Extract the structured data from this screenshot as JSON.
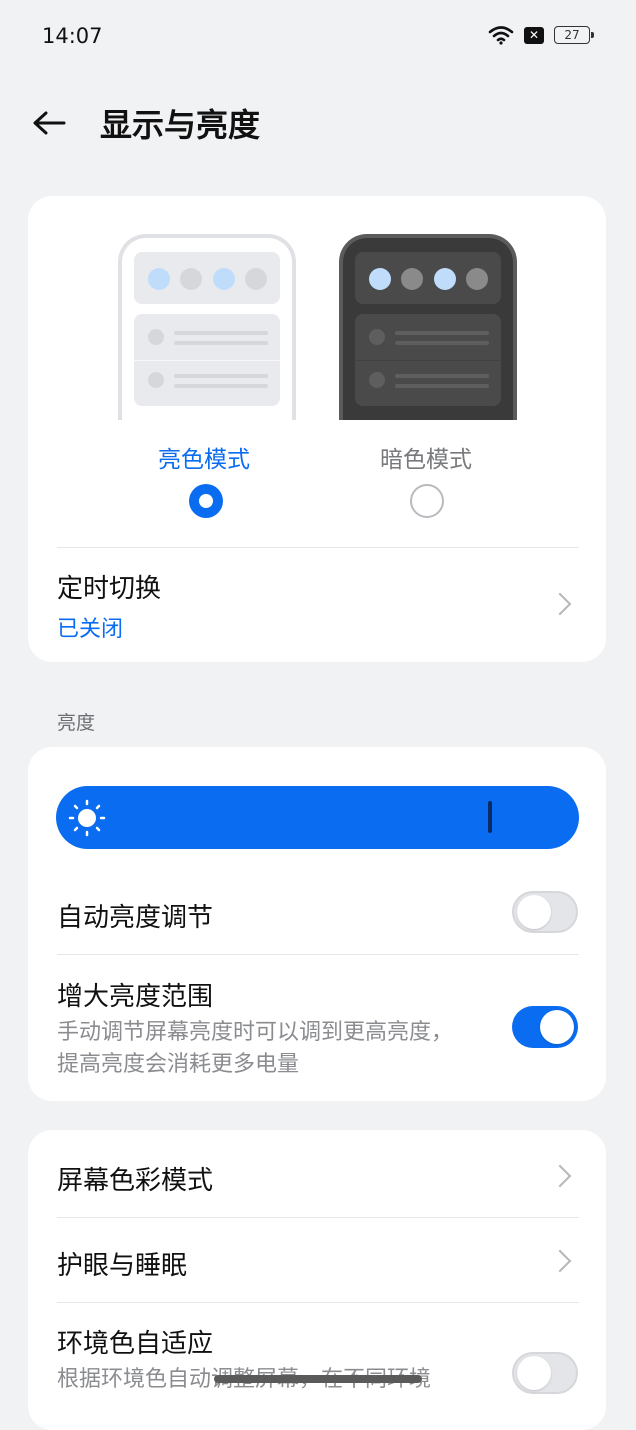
{
  "status": {
    "time": "14:07",
    "battery": "27",
    "wifi_icon": "wifi-icon",
    "sim_icon": "no-sim-icon"
  },
  "header": {
    "title": "显示与亮度",
    "back_icon": "back-arrow-icon"
  },
  "theme": {
    "light_label": "亮色模式",
    "dark_label": "暗色模式",
    "selected": "light",
    "schedule_title": "定时切换",
    "schedule_status": "已关闭"
  },
  "brightness": {
    "section_label": "亮度",
    "level": 0.83,
    "auto_label": "自动亮度调节",
    "auto_on": false,
    "extend_label": "增大亮度范围",
    "extend_desc": "手动调节屏幕亮度时可以调到更高亮度，提高亮度会消耗更多电量",
    "extend_on": true
  },
  "color": {
    "screen_color_label": "屏幕色彩模式",
    "eye_sleep_label": "护眼与睡眠",
    "ambient_label": "环境色自适应",
    "ambient_desc": "根据环境色自动调整屏幕，在不同环境",
    "ambient_on": false
  },
  "colors": {
    "accent": "#0a6cf0",
    "background": "#f1f2f4"
  }
}
